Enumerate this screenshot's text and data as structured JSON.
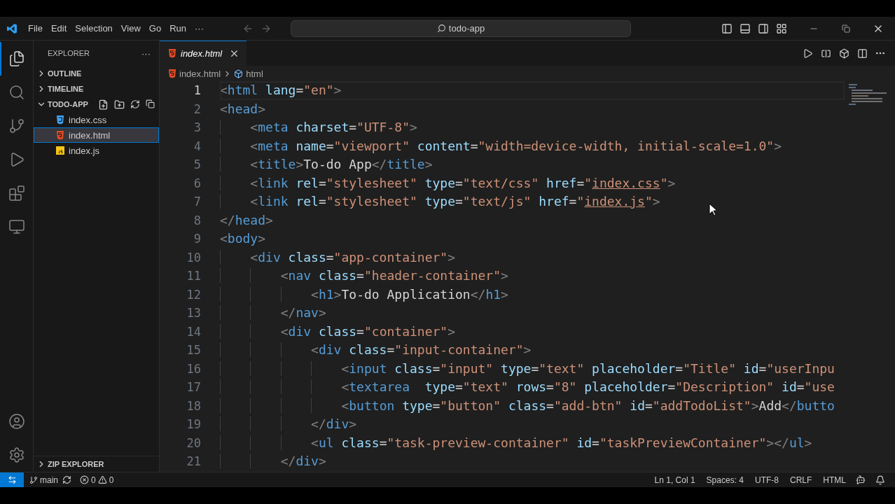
{
  "title_bar": {
    "menu": [
      "File",
      "Edit",
      "Selection",
      "View",
      "Go",
      "Run",
      "···"
    ],
    "search": "todo-app"
  },
  "activity_bar": [
    {
      "kind": "explorer",
      "selected": true
    },
    {
      "kind": "search",
      "selected": false
    },
    {
      "kind": "source-control",
      "selected": false
    },
    {
      "kind": "run",
      "selected": false
    },
    {
      "kind": "extensions",
      "selected": false
    },
    {
      "kind": "remote",
      "selected": false
    }
  ],
  "sidebar": {
    "title": "EXPLORER",
    "menu": "···",
    "sections": [
      {
        "label": "OUTLINE",
        "expanded": false
      },
      {
        "label": "TIMELINE",
        "expanded": false
      },
      {
        "label": "TODO-APP",
        "expanded": true,
        "files": [
          {
            "label": "index.css",
            "kind": "css",
            "selected": false
          },
          {
            "label": "index.html",
            "kind": "html",
            "selected": true
          },
          {
            "label": "index.js",
            "kind": "js",
            "selected": false
          }
        ]
      }
    ],
    "footer_section": {
      "label": "ZIP EXPLORER",
      "expanded": false
    }
  },
  "tabs": [
    {
      "label": "index.html",
      "kind": "html",
      "selected": true
    }
  ],
  "breadcrumbs": [
    {
      "kind": "file",
      "text": "index.html"
    },
    {
      "kind": "element",
      "text": "html"
    }
  ],
  "editor": {
    "lines": [
      {
        "number": "1",
        "current": true,
        "tokens": [
          {
            "kind": "bracket",
            "text": "<"
          },
          {
            "kind": "tag",
            "text": "html"
          },
          {
            "kind": "attr",
            "text": " lang"
          },
          {
            "kind": "text",
            "text": "="
          },
          {
            "kind": "string",
            "text": "\"en\""
          },
          {
            "kind": "bracket",
            "text": ">"
          }
        ]
      },
      {
        "number": "2",
        "current": false,
        "tokens": [
          {
            "kind": "bracket",
            "text": "<"
          },
          {
            "kind": "tag",
            "text": "head"
          },
          {
            "kind": "bracket",
            "text": ">"
          }
        ]
      },
      {
        "number": "3",
        "current": false,
        "tokens": [
          {
            "kind": "bracket",
            "text": "    <"
          },
          {
            "kind": "tag",
            "text": "meta"
          },
          {
            "kind": "attr",
            "text": " charset"
          },
          {
            "kind": "text",
            "text": "="
          },
          {
            "kind": "string",
            "text": "\"UTF-8\""
          },
          {
            "kind": "bracket",
            "text": ">"
          }
        ]
      },
      {
        "number": "4",
        "current": false,
        "tokens": [
          {
            "kind": "bracket",
            "text": "    <"
          },
          {
            "kind": "tag",
            "text": "meta"
          },
          {
            "kind": "attr",
            "text": " name"
          },
          {
            "kind": "text",
            "text": "="
          },
          {
            "kind": "string",
            "text": "\"viewport\""
          },
          {
            "kind": "attr",
            "text": " content"
          },
          {
            "kind": "text",
            "text": "="
          },
          {
            "kind": "string",
            "text": "\"width=device-width, initial-scale=1.0\""
          },
          {
            "kind": "bracket",
            "text": ">"
          }
        ]
      },
      {
        "number": "5",
        "current": false,
        "tokens": [
          {
            "kind": "bracket",
            "text": "    <"
          },
          {
            "kind": "tag",
            "text": "title"
          },
          {
            "kind": "bracket",
            "text": ">"
          },
          {
            "kind": "text",
            "text": "To-do App"
          },
          {
            "kind": "bracket",
            "text": "</"
          },
          {
            "kind": "tag",
            "text": "title"
          },
          {
            "kind": "bracket",
            "text": ">"
          }
        ]
      },
      {
        "number": "6",
        "current": false,
        "tokens": [
          {
            "kind": "bracket",
            "text": "    <"
          },
          {
            "kind": "tag",
            "text": "link"
          },
          {
            "kind": "attr",
            "text": " rel"
          },
          {
            "kind": "text",
            "text": "="
          },
          {
            "kind": "string",
            "text": "\"stylesheet\""
          },
          {
            "kind": "attr",
            "text": " type"
          },
          {
            "kind": "text",
            "text": "="
          },
          {
            "kind": "string",
            "text": "\"text/css\""
          },
          {
            "kind": "attr",
            "text": " href"
          },
          {
            "kind": "text",
            "text": "="
          },
          {
            "kind": "string",
            "text": "\""
          },
          {
            "kind": "link",
            "text": "index.css"
          },
          {
            "kind": "string",
            "text": "\""
          },
          {
            "kind": "bracket",
            "text": ">"
          }
        ]
      },
      {
        "number": "7",
        "current": false,
        "tokens": [
          {
            "kind": "bracket",
            "text": "    <"
          },
          {
            "kind": "tag",
            "text": "link"
          },
          {
            "kind": "attr",
            "text": " rel"
          },
          {
            "kind": "text",
            "text": "="
          },
          {
            "kind": "string",
            "text": "\"stylesheet\""
          },
          {
            "kind": "attr",
            "text": " type"
          },
          {
            "kind": "text",
            "text": "="
          },
          {
            "kind": "string",
            "text": "\"text/js\""
          },
          {
            "kind": "attr",
            "text": " href"
          },
          {
            "kind": "text",
            "text": "="
          },
          {
            "kind": "string",
            "text": "\""
          },
          {
            "kind": "link",
            "text": "index.js"
          },
          {
            "kind": "string",
            "text": "\""
          },
          {
            "kind": "bracket",
            "text": ">"
          }
        ]
      },
      {
        "number": "8",
        "current": false,
        "tokens": [
          {
            "kind": "bracket",
            "text": "</"
          },
          {
            "kind": "tag",
            "text": "head"
          },
          {
            "kind": "bracket",
            "text": ">"
          }
        ]
      },
      {
        "number": "9",
        "current": false,
        "tokens": [
          {
            "kind": "bracket",
            "text": "<"
          },
          {
            "kind": "tag",
            "text": "body"
          },
          {
            "kind": "bracket",
            "text": ">"
          }
        ]
      },
      {
        "number": "10",
        "current": false,
        "tokens": [
          {
            "kind": "bracket",
            "text": "    <"
          },
          {
            "kind": "tag",
            "text": "div"
          },
          {
            "kind": "attr",
            "text": " class"
          },
          {
            "kind": "text",
            "text": "="
          },
          {
            "kind": "string",
            "text": "\"app-container\""
          },
          {
            "kind": "bracket",
            "text": ">"
          }
        ]
      },
      {
        "number": "11",
        "current": false,
        "tokens": [
          {
            "kind": "bracket",
            "text": "        <"
          },
          {
            "kind": "tag",
            "text": "nav"
          },
          {
            "kind": "attr",
            "text": " class"
          },
          {
            "kind": "text",
            "text": "="
          },
          {
            "kind": "string",
            "text": "\"header-container\""
          },
          {
            "kind": "bracket",
            "text": ">"
          }
        ]
      },
      {
        "number": "12",
        "current": false,
        "tokens": [
          {
            "kind": "bracket",
            "text": "            <"
          },
          {
            "kind": "tag",
            "text": "h1"
          },
          {
            "kind": "bracket",
            "text": ">"
          },
          {
            "kind": "text",
            "text": "To-do Application"
          },
          {
            "kind": "bracket",
            "text": "</"
          },
          {
            "kind": "tag",
            "text": "h1"
          },
          {
            "kind": "bracket",
            "text": ">"
          }
        ]
      },
      {
        "number": "13",
        "current": false,
        "tokens": [
          {
            "kind": "bracket",
            "text": "        </"
          },
          {
            "kind": "tag",
            "text": "nav"
          },
          {
            "kind": "bracket",
            "text": ">"
          }
        ]
      },
      {
        "number": "14",
        "current": false,
        "tokens": [
          {
            "kind": "bracket",
            "text": "        <"
          },
          {
            "kind": "tag",
            "text": "div"
          },
          {
            "kind": "attr",
            "text": " class"
          },
          {
            "kind": "text",
            "text": "="
          },
          {
            "kind": "string",
            "text": "\"container\""
          },
          {
            "kind": "bracket",
            "text": ">"
          }
        ]
      },
      {
        "number": "15",
        "current": false,
        "tokens": [
          {
            "kind": "bracket",
            "text": "            <"
          },
          {
            "kind": "tag",
            "text": "div"
          },
          {
            "kind": "attr",
            "text": " class"
          },
          {
            "kind": "text",
            "text": "="
          },
          {
            "kind": "string",
            "text": "\"input-container\""
          },
          {
            "kind": "bracket",
            "text": ">"
          }
        ]
      },
      {
        "number": "16",
        "current": false,
        "tokens": [
          {
            "kind": "bracket",
            "text": "                <"
          },
          {
            "kind": "tag",
            "text": "input"
          },
          {
            "kind": "attr",
            "text": " class"
          },
          {
            "kind": "text",
            "text": "="
          },
          {
            "kind": "string",
            "text": "\"input\""
          },
          {
            "kind": "attr",
            "text": " type"
          },
          {
            "kind": "text",
            "text": "="
          },
          {
            "kind": "string",
            "text": "\"text\""
          },
          {
            "kind": "attr",
            "text": " placeholder"
          },
          {
            "kind": "text",
            "text": "="
          },
          {
            "kind": "string",
            "text": "\"Title\""
          },
          {
            "kind": "attr",
            "text": " id"
          },
          {
            "kind": "text",
            "text": "="
          },
          {
            "kind": "string",
            "text": "\"userInpu"
          }
        ]
      },
      {
        "number": "17",
        "current": false,
        "tokens": [
          {
            "kind": "bracket",
            "text": "                <"
          },
          {
            "kind": "tag",
            "text": "textarea"
          },
          {
            "kind": "attr",
            "text": "  type"
          },
          {
            "kind": "text",
            "text": "="
          },
          {
            "kind": "string",
            "text": "\"text\""
          },
          {
            "kind": "attr",
            "text": " rows"
          },
          {
            "kind": "text",
            "text": "="
          },
          {
            "kind": "string",
            "text": "\"8\""
          },
          {
            "kind": "attr",
            "text": " placeholder"
          },
          {
            "kind": "text",
            "text": "="
          },
          {
            "kind": "string",
            "text": "\"Description\""
          },
          {
            "kind": "attr",
            "text": " id"
          },
          {
            "kind": "text",
            "text": "="
          },
          {
            "kind": "string",
            "text": "\"use"
          }
        ]
      },
      {
        "number": "18",
        "current": false,
        "tokens": [
          {
            "kind": "bracket",
            "text": "                <"
          },
          {
            "kind": "tag",
            "text": "button"
          },
          {
            "kind": "attr",
            "text": " type"
          },
          {
            "kind": "text",
            "text": "="
          },
          {
            "kind": "string",
            "text": "\"button\""
          },
          {
            "kind": "attr",
            "text": " class"
          },
          {
            "kind": "text",
            "text": "="
          },
          {
            "kind": "string",
            "text": "\"add-btn\""
          },
          {
            "kind": "attr",
            "text": " id"
          },
          {
            "kind": "text",
            "text": "="
          },
          {
            "kind": "string",
            "text": "\"addTodoList\""
          },
          {
            "kind": "bracket",
            "text": ">"
          },
          {
            "kind": "text",
            "text": "Add"
          },
          {
            "kind": "bracket",
            "text": "</"
          },
          {
            "kind": "tag",
            "text": "butto"
          }
        ]
      },
      {
        "number": "19",
        "current": false,
        "tokens": [
          {
            "kind": "bracket",
            "text": "            </"
          },
          {
            "kind": "tag",
            "text": "div"
          },
          {
            "kind": "bracket",
            "text": ">"
          }
        ]
      },
      {
        "number": "20",
        "current": false,
        "tokens": [
          {
            "kind": "bracket",
            "text": "            <"
          },
          {
            "kind": "tag",
            "text": "ul"
          },
          {
            "kind": "attr",
            "text": " class"
          },
          {
            "kind": "text",
            "text": "="
          },
          {
            "kind": "string",
            "text": "\"task-preview-container\""
          },
          {
            "kind": "attr",
            "text": " id"
          },
          {
            "kind": "text",
            "text": "="
          },
          {
            "kind": "string",
            "text": "\"taskPreviewContainer\""
          },
          {
            "kind": "bracket",
            "text": ">"
          },
          {
            "kind": "bracket",
            "text": "</"
          },
          {
            "kind": "tag",
            "text": "ul"
          },
          {
            "kind": "bracket",
            "text": ">"
          }
        ]
      },
      {
        "number": "21",
        "current": false,
        "tokens": [
          {
            "kind": "bracket",
            "text": "        </"
          },
          {
            "kind": "tag",
            "text": "div"
          },
          {
            "kind": "bracket",
            "text": ">"
          }
        ]
      }
    ]
  },
  "status_bar": {
    "branch": "main",
    "errors": "0",
    "warnings": "0",
    "items": [
      "Ln 1, Col 1",
      "Spaces: 4",
      "UTF-8",
      "CRLF",
      "HTML"
    ]
  }
}
